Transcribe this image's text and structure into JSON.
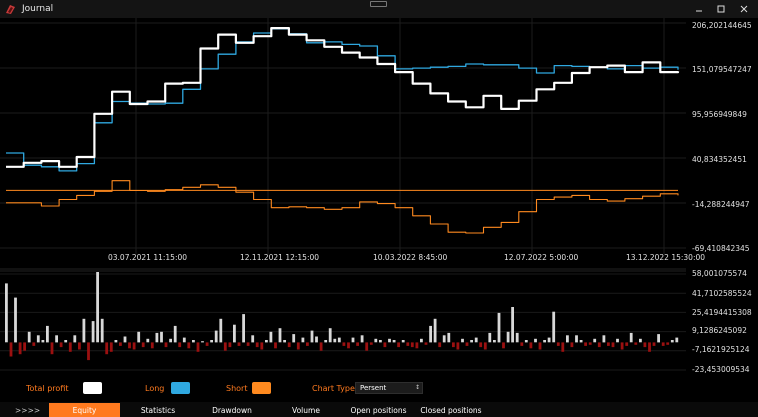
{
  "window": {
    "title": "Journal",
    "icon": "journal-app-icon",
    "controls": [
      "minimize-icon",
      "maximize-icon",
      "close-icon"
    ]
  },
  "equity_chart": {
    "y_ticks": [
      "206,202144645",
      "151,079547247",
      "95,956949849",
      "40,834352451",
      "-14,288244947",
      "-69,410842345"
    ],
    "x_ticks": [
      "03.07.2021 11:15:00",
      "12.11.2021 12:15:00",
      "10.03.2022 8:45:00",
      "12.07.2022 5:00:00",
      "13.12.2022 15:30:00"
    ]
  },
  "volume_chart": {
    "y_ticks": [
      "58,001075574",
      "41,7102585524",
      "25,4194415308",
      "9,1286245092",
      "-7,1621925124",
      "-23,453009534"
    ]
  },
  "legend": {
    "total_profit_label": "Total profit",
    "long_label": "Long",
    "short_label": "Short",
    "chart_type_label": "Chart Type",
    "chart_type_value": "Persent"
  },
  "colors": {
    "total_profit": "#ffffff",
    "long": "#2fa8e0",
    "short": "#ff8a1f",
    "positive_bar": "#d8d8d8",
    "negative_bar": "#9b1010",
    "accent": "#ff7a1f"
  },
  "tabs": {
    "more": ">>>>",
    "items": [
      "Equity",
      "Statistics",
      "Drawdown",
      "Volume",
      "Open positions",
      "Closed positions"
    ],
    "active": "Equity"
  },
  "chart_data": [
    {
      "type": "line",
      "x": [
        "03.07.2021 11:15:00",
        "12.11.2021 12:15:00",
        "10.03.2022 8:45:00",
        "12.07.2022 5:00:00",
        "13.12.2022 15:30:00"
      ],
      "ylim": [
        -69.410842345,
        206.202144645
      ],
      "grid": true,
      "series": [
        {
          "name": "Total profit",
          "values": [
            30,
            35,
            37,
            30,
            42,
            95,
            122,
            107,
            110,
            132,
            133,
            175,
            192,
            182,
            190,
            200,
            192,
            185,
            177,
            170,
            164,
            156,
            146,
            132,
            120,
            110,
            103,
            117,
            101,
            111,
            125,
            133,
            145,
            152,
            154,
            146,
            158,
            146,
            147
          ]
        },
        {
          "name": "Long",
          "values": [
            47,
            32,
            30,
            25,
            34,
            84,
            110,
            108,
            107,
            108,
            125,
            150,
            168,
            183,
            194,
            199,
            193,
            182,
            183,
            180,
            178,
            166,
            150,
            151,
            152,
            153,
            156,
            155,
            155,
            151,
            145,
            154,
            153,
            152,
            150,
            154,
            151,
            152,
            149
          ]
        },
        {
          "name": "Short",
          "values": [
            -14,
            -14,
            -18,
            -10,
            -5,
            0,
            13,
            1,
            0,
            2,
            5,
            8,
            5,
            -1,
            -10,
            -20,
            -19,
            -20,
            -22,
            -20,
            -13,
            -15,
            -20,
            -30,
            -40,
            -50,
            -51,
            -44,
            -38,
            -25,
            -10,
            -7,
            -5,
            -10,
            -12,
            -9,
            -6,
            -3,
            -5
          ]
        }
      ]
    },
    {
      "type": "bar",
      "ylim": [
        -23.453009534,
        58.001075574
      ],
      "values": [
        50,
        -12,
        38,
        -10,
        -7,
        9,
        -3,
        6,
        2,
        14,
        -10,
        6,
        -4,
        2,
        -8,
        6,
        -6,
        20,
        -15,
        18,
        60,
        20,
        -10,
        -8,
        2,
        -3,
        5,
        -5,
        -6,
        9,
        -4,
        3,
        -5,
        8,
        9,
        -4,
        3,
        14,
        -4,
        4,
        -5,
        2,
        -8,
        1,
        -3,
        2,
        10,
        20,
        -7,
        -4,
        15,
        -3,
        24,
        -3,
        6,
        -4,
        -6,
        2,
        9,
        -5,
        12,
        2,
        -4,
        7,
        -6,
        4,
        -3,
        10,
        5,
        -7,
        2,
        12,
        3,
        4,
        -3,
        -5,
        4,
        -3,
        6,
        -7,
        -2,
        3,
        2,
        -4,
        3,
        2,
        -4,
        2,
        -3,
        -4,
        -5,
        3,
        -2,
        14,
        20,
        -4,
        6,
        8,
        -4,
        -6,
        3,
        -3,
        2,
        4,
        -4,
        -6,
        8,
        2,
        25,
        -5,
        9,
        30,
        8,
        -3,
        2,
        -5,
        3,
        -6,
        2,
        4,
        26,
        -3,
        -8,
        6,
        -4,
        6,
        2,
        -3,
        -2,
        3,
        -4,
        6,
        -3,
        -4,
        3,
        -6,
        -3,
        8,
        -2,
        3,
        -4,
        -8,
        -3,
        7,
        -3,
        -2,
        2,
        4
      ]
    }
  ]
}
